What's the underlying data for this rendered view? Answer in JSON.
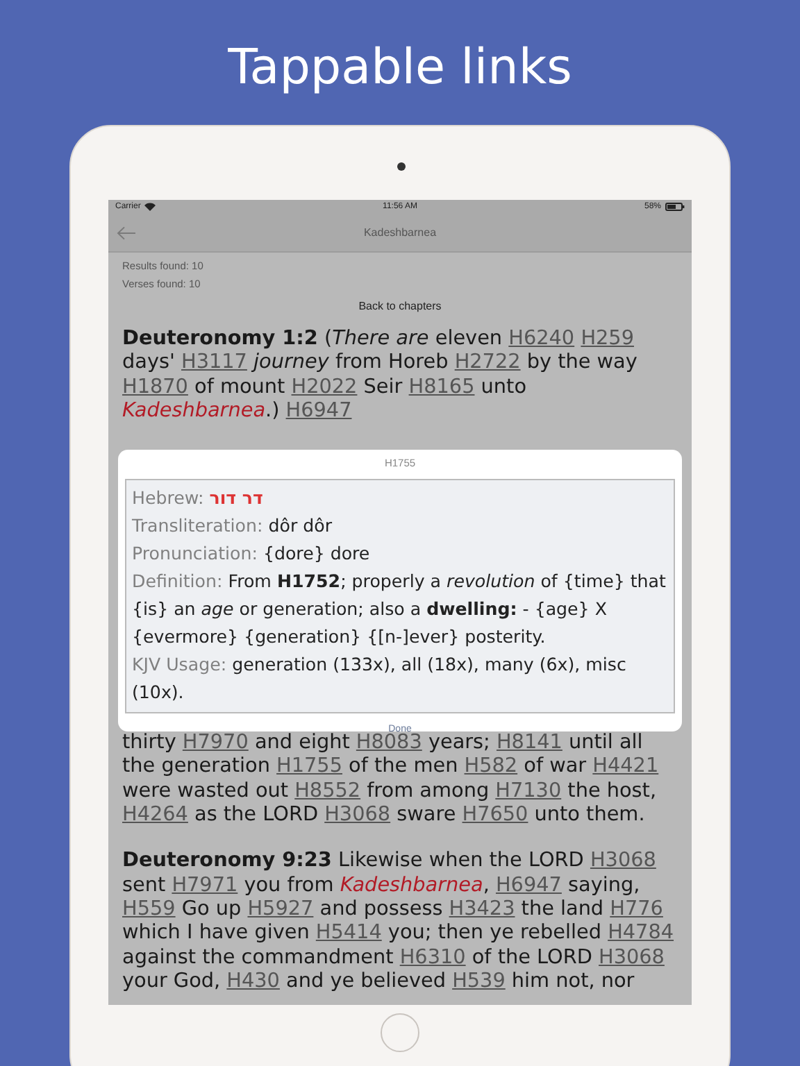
{
  "headline": "Tappable links",
  "status_bar": {
    "carrier": "Carrier",
    "time": "11:56 AM",
    "battery": "58%"
  },
  "nav": {
    "title": "Kadeshbarnea"
  },
  "results": [
    "Results found: 10",
    "Verses found: 10"
  ],
  "back_link": "Back to chapters",
  "verses": [
    {
      "segments": [
        {
          "kind": "ref",
          "text": "Deuteronomy 1:2"
        },
        {
          "kind": "text",
          "text": " ("
        },
        {
          "kind": "italic",
          "text": "There are"
        },
        {
          "kind": "text",
          "text": " eleven "
        },
        {
          "kind": "link",
          "text": "H6240"
        },
        {
          "kind": "space"
        },
        {
          "kind": "link",
          "text": "H259"
        },
        {
          "kind": "text",
          "text": " days' "
        },
        {
          "kind": "link",
          "text": "H3117"
        },
        {
          "kind": "space"
        },
        {
          "kind": "italic",
          "text": "journey"
        },
        {
          "kind": "text",
          "text": " from Horeb "
        },
        {
          "kind": "link",
          "text": "H2722"
        },
        {
          "kind": "text",
          "text": " by the way "
        },
        {
          "kind": "link",
          "text": "H1870"
        },
        {
          "kind": "text",
          "text": " of mount "
        },
        {
          "kind": "link",
          "text": "H2022"
        },
        {
          "kind": "text",
          "text": " Seir "
        },
        {
          "kind": "link",
          "text": "H8165"
        },
        {
          "kind": "text",
          "text": " unto "
        },
        {
          "kind": "name",
          "text": "Kadeshbarnea"
        },
        {
          "kind": "text",
          "text": ".) "
        },
        {
          "kind": "link",
          "text": "H6947"
        }
      ]
    },
    {
      "segments": [
        {
          "kind": "text",
          "text": "thirty "
        },
        {
          "kind": "link",
          "text": "H7970"
        },
        {
          "kind": "text",
          "text": " and eight "
        },
        {
          "kind": "link",
          "text": "H8083"
        },
        {
          "kind": "text",
          "text": " years; "
        },
        {
          "kind": "link",
          "text": "H8141"
        },
        {
          "kind": "text",
          "text": " until all the generation "
        },
        {
          "kind": "link",
          "text": "H1755"
        },
        {
          "kind": "text",
          "text": " of the men "
        },
        {
          "kind": "link",
          "text": "H582"
        },
        {
          "kind": "text",
          "text": " of war "
        },
        {
          "kind": "link",
          "text": "H4421"
        },
        {
          "kind": "text",
          "text": " were wasted out "
        },
        {
          "kind": "link",
          "text": "H8552"
        },
        {
          "kind": "text",
          "text": " from among "
        },
        {
          "kind": "link",
          "text": "H7130"
        },
        {
          "kind": "text",
          "text": " the host, "
        },
        {
          "kind": "link",
          "text": "H4264"
        },
        {
          "kind": "text",
          "text": " as the LORD "
        },
        {
          "kind": "link",
          "text": "H3068"
        },
        {
          "kind": "text",
          "text": " sware "
        },
        {
          "kind": "link",
          "text": "H7650"
        },
        {
          "kind": "text",
          "text": " unto them."
        }
      ]
    },
    {
      "segments": [
        {
          "kind": "ref",
          "text": "Deuteronomy 9:23"
        },
        {
          "kind": "text",
          "text": " Likewise when the LORD "
        },
        {
          "kind": "link",
          "text": "H3068"
        },
        {
          "kind": "text",
          "text": " sent "
        },
        {
          "kind": "link",
          "text": "H7971"
        },
        {
          "kind": "text",
          "text": " you from "
        },
        {
          "kind": "name",
          "text": "Kadeshbarnea"
        },
        {
          "kind": "text",
          "text": ", "
        },
        {
          "kind": "link",
          "text": "H6947"
        },
        {
          "kind": "text",
          "text": " saying, "
        },
        {
          "kind": "link",
          "text": "H559"
        },
        {
          "kind": "text",
          "text": " Go up "
        },
        {
          "kind": "link",
          "text": "H5927"
        },
        {
          "kind": "text",
          "text": " and possess "
        },
        {
          "kind": "link",
          "text": "H3423"
        },
        {
          "kind": "text",
          "text": " the land "
        },
        {
          "kind": "link",
          "text": "H776"
        },
        {
          "kind": "text",
          "text": " which I have given "
        },
        {
          "kind": "link",
          "text": "H5414"
        },
        {
          "kind": "text",
          "text": " you; then ye rebelled "
        },
        {
          "kind": "link",
          "text": "H4784"
        },
        {
          "kind": "text",
          "text": " against the commandment "
        },
        {
          "kind": "link",
          "text": "H6310"
        },
        {
          "kind": "text",
          "text": " of the LORD "
        },
        {
          "kind": "link",
          "text": "H3068"
        },
        {
          "kind": "text",
          "text": " your God, "
        },
        {
          "kind": "link",
          "text": "H430"
        },
        {
          "kind": "text",
          "text": " and ye believed "
        },
        {
          "kind": "link",
          "text": "H539"
        },
        {
          "kind": "text",
          "text": " him not, nor"
        }
      ]
    }
  ],
  "dialog": {
    "title": "H1755",
    "fields": [
      {
        "kind": "hebrew",
        "label": "Hebrew:",
        "value": "דר דור"
      },
      {
        "kind": "plain",
        "label": "Transliteration:",
        "value": "dôr dôr"
      },
      {
        "kind": "plain",
        "label": "Pronunciation:",
        "value": "{dore} dore"
      },
      {
        "kind": "plain",
        "label": "Definition:",
        "value": "From **H1752**; properly a *revolution* of {time} that {is} an *age* or generation; also a **dwelling:** - {age} X {evermore} {generation} {[n-]ever} posterity."
      },
      {
        "kind": "plain",
        "label": "KJV Usage:",
        "value": "generation (133x), all (18x), many (6x), misc (10x)."
      }
    ],
    "button": "Done"
  }
}
